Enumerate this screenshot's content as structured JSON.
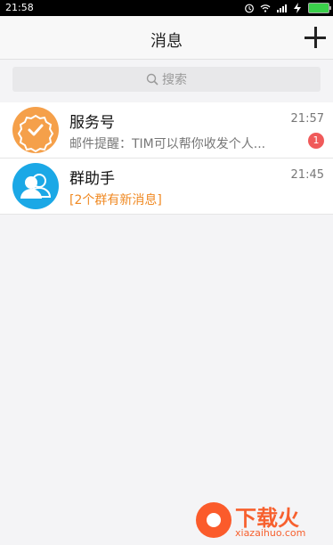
{
  "status_bar": {
    "time": "21:58",
    "icons": [
      "alarm-icon",
      "wifi-icon",
      "signal-icon",
      "charging-icon",
      "battery-icon"
    ]
  },
  "header": {
    "title": "消息",
    "add_icon": "plus-icon"
  },
  "search": {
    "placeholder": "搜索",
    "icon": "search-icon"
  },
  "messages": [
    {
      "name": "服务号",
      "preview": "邮件提醒：TIM可以帮你收发个人...",
      "time": "21:57",
      "badge": "1",
      "avatar_color": "#f5a04a",
      "avatar_icon": "verified-badge-icon"
    },
    {
      "name": "群助手",
      "preview": "[2个群有新消息]",
      "time": "21:45",
      "avatar_color": "#1ba8e6",
      "avatar_icon": "group-people-icon"
    }
  ],
  "watermark": {
    "title": "下载火",
    "url": "xiazaihuo.com",
    "color": "#f7602e"
  }
}
